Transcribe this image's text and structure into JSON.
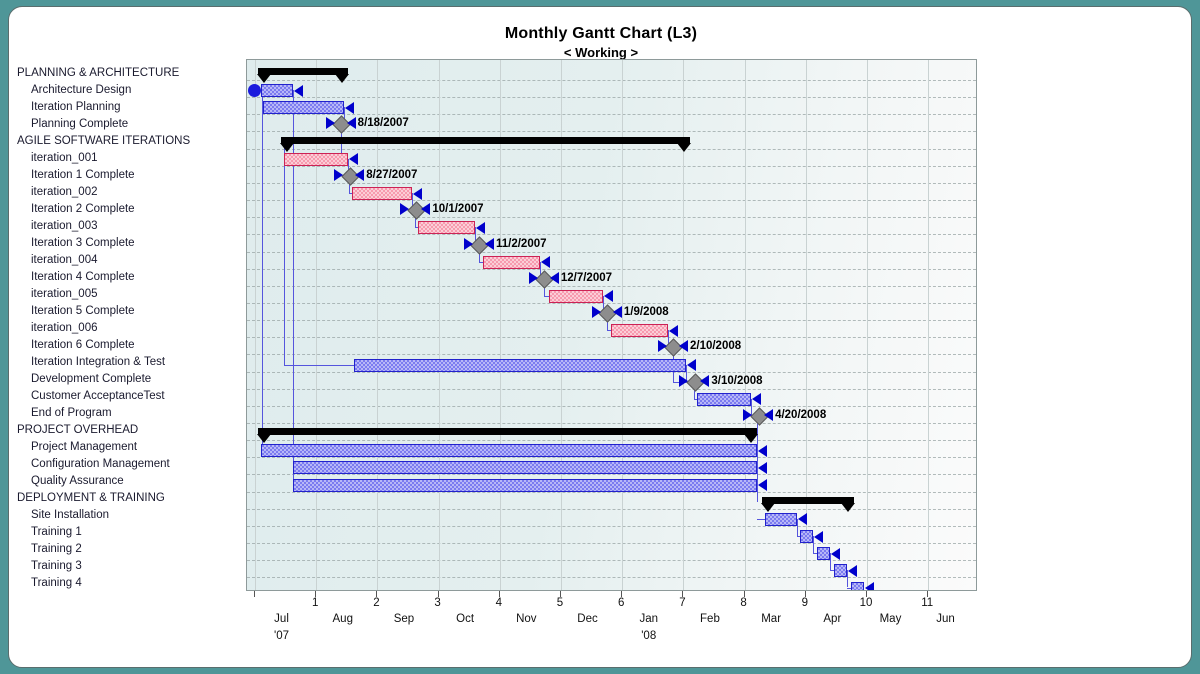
{
  "header": {
    "title": "Monthly Gantt Chart  (L3)",
    "subtitle": "< Working >"
  },
  "tasks": [
    {
      "label": "PLANNING & ARCHITECTURE",
      "type": "group"
    },
    {
      "label": "Architecture Design",
      "type": "task"
    },
    {
      "label": "Iteration Planning",
      "type": "task"
    },
    {
      "label": "Planning Complete",
      "type": "milestone"
    },
    {
      "label": "AGILE SOFTWARE ITERATIONS",
      "type": "group"
    },
    {
      "label": "iteration_001",
      "type": "task"
    },
    {
      "label": "Iteration 1 Complete",
      "type": "milestone"
    },
    {
      "label": "iteration_002",
      "type": "task"
    },
    {
      "label": "Iteration 2 Complete",
      "type": "milestone"
    },
    {
      "label": "iteration_003",
      "type": "task"
    },
    {
      "label": "Iteration 3 Complete",
      "type": "milestone"
    },
    {
      "label": "iteration_004",
      "type": "task"
    },
    {
      "label": "Iteration 4 Complete",
      "type": "milestone"
    },
    {
      "label": "iteration_005",
      "type": "task"
    },
    {
      "label": "Iteration 5 Complete",
      "type": "milestone"
    },
    {
      "label": "iteration_006",
      "type": "task"
    },
    {
      "label": "Iteration 6 Complete",
      "type": "milestone"
    },
    {
      "label": "Iteration Integration & Test",
      "type": "task"
    },
    {
      "label": "Development Complete",
      "type": "milestone"
    },
    {
      "label": "Customer AcceptanceTest",
      "type": "task"
    },
    {
      "label": "End of Program",
      "type": "milestone"
    },
    {
      "label": "PROJECT OVERHEAD",
      "type": "group"
    },
    {
      "label": "Project Management",
      "type": "task"
    },
    {
      "label": "Configuration Management",
      "type": "task"
    },
    {
      "label": "Quality Assurance",
      "type": "task"
    },
    {
      "label": "DEPLOYMENT & TRAINING",
      "type": "group"
    },
    {
      "label": "Site Installation",
      "type": "task"
    },
    {
      "label": "Training 1",
      "type": "task"
    },
    {
      "label": "Training 2",
      "type": "task"
    },
    {
      "label": "Training 3",
      "type": "task"
    },
    {
      "label": "Training 4",
      "type": "task"
    }
  ],
  "chart_data": {
    "type": "bar",
    "subtype": "gantt",
    "title": "Monthly Gantt Chart  (L3)",
    "subtitle": "< Working >",
    "xlabel": "",
    "ylabel": "",
    "xlim": [
      0,
      11.6
    ],
    "axis_unit": "months",
    "grid": true,
    "legend_position": "none",
    "x_ticks": [
      {
        "value": 0,
        "label": "0",
        "shown": false
      },
      {
        "value": 1,
        "label": "1"
      },
      {
        "value": 2,
        "label": "2"
      },
      {
        "value": 3,
        "label": "3"
      },
      {
        "value": 4,
        "label": "4"
      },
      {
        "value": 5,
        "label": "5"
      },
      {
        "value": 6,
        "label": "6"
      },
      {
        "value": 7,
        "label": "7"
      },
      {
        "value": 8,
        "label": "8"
      },
      {
        "value": 9,
        "label": "9"
      },
      {
        "value": 10,
        "label": "10"
      },
      {
        "value": 11,
        "label": "11"
      }
    ],
    "month_labels": [
      {
        "value": 0.45,
        "label": "Jul",
        "year": "'07"
      },
      {
        "value": 1.45,
        "label": "Aug"
      },
      {
        "value": 2.45,
        "label": "Sep"
      },
      {
        "value": 3.45,
        "label": "Oct"
      },
      {
        "value": 4.45,
        "label": "Nov"
      },
      {
        "value": 5.45,
        "label": "Dec"
      },
      {
        "value": 6.45,
        "label": "Jan",
        "year": "'08"
      },
      {
        "value": 7.45,
        "label": "Feb"
      },
      {
        "value": 8.45,
        "label": "Mar"
      },
      {
        "value": 9.45,
        "label": "Apr"
      },
      {
        "value": 10.4,
        "label": "May"
      },
      {
        "value": 11.3,
        "label": "Jun"
      }
    ],
    "bars": [
      {
        "row": 0,
        "name": "PLANNING & ARCHITECTURE",
        "kind": "summary",
        "start": 0.05,
        "end": 1.52
      },
      {
        "row": 1,
        "name": "Architecture Design",
        "kind": "task",
        "color": "blue",
        "start": 0.1,
        "end": 0.62,
        "start_marker": "circle"
      },
      {
        "row": 2,
        "name": "Iteration Planning",
        "kind": "task",
        "color": "blue",
        "start": 0.13,
        "end": 1.45
      },
      {
        "row": 3,
        "name": "Planning Complete",
        "kind": "milestone",
        "at": 1.4,
        "date": "8/18/2007"
      },
      {
        "row": 4,
        "name": "AGILE SOFTWARE ITERATIONS",
        "kind": "summary",
        "start": 0.42,
        "end": 7.1
      },
      {
        "row": 5,
        "name": "iteration_001",
        "kind": "task",
        "color": "pink",
        "start": 0.47,
        "end": 1.52
      },
      {
        "row": 6,
        "name": "Iteration 1 Complete",
        "kind": "milestone",
        "at": 1.54,
        "date": "8/27/2007"
      },
      {
        "row": 7,
        "name": "iteration_002",
        "kind": "task",
        "color": "pink",
        "start": 1.59,
        "end": 2.57
      },
      {
        "row": 8,
        "name": "Iteration 2 Complete",
        "kind": "milestone",
        "at": 2.62,
        "date": "10/1/2007"
      },
      {
        "row": 9,
        "name": "iteration_003",
        "kind": "task",
        "color": "pink",
        "start": 2.66,
        "end": 3.6
      },
      {
        "row": 10,
        "name": "Iteration 3 Complete",
        "kind": "milestone",
        "at": 3.66,
        "date": "11/2/2007"
      },
      {
        "row": 11,
        "name": "iteration_004",
        "kind": "task",
        "color": "pink",
        "start": 3.73,
        "end": 4.66
      },
      {
        "row": 12,
        "name": "Iteration 4 Complete",
        "kind": "milestone",
        "at": 4.72,
        "date": "12/7/2007"
      },
      {
        "row": 13,
        "name": "iteration_005",
        "kind": "task",
        "color": "pink",
        "start": 4.8,
        "end": 5.69
      },
      {
        "row": 14,
        "name": "Iteration 5 Complete",
        "kind": "milestone",
        "at": 5.75,
        "date": "1/9/2008"
      },
      {
        "row": 15,
        "name": "iteration_006",
        "kind": "task",
        "color": "pink",
        "start": 5.82,
        "end": 6.75
      },
      {
        "row": 16,
        "name": "Iteration 6 Complete",
        "kind": "milestone",
        "at": 6.83,
        "date": "2/10/2008"
      },
      {
        "row": 17,
        "name": "Iteration Integration & Test",
        "kind": "task",
        "color": "blue",
        "start": 1.62,
        "end": 7.05
      },
      {
        "row": 18,
        "name": "Development Complete",
        "kind": "milestone",
        "at": 7.18,
        "date": "3/10/2008"
      },
      {
        "row": 19,
        "name": "Customer AcceptanceTest",
        "kind": "task",
        "color": "blue",
        "start": 7.22,
        "end": 8.11
      },
      {
        "row": 20,
        "name": "End of Program",
        "kind": "milestone",
        "at": 8.22,
        "date": "4/20/2008"
      },
      {
        "row": 21,
        "name": "PROJECT OVERHEAD",
        "kind": "summary",
        "start": 0.05,
        "end": 8.2
      },
      {
        "row": 22,
        "name": "Project Management",
        "kind": "task",
        "color": "blue",
        "start": 0.09,
        "end": 8.2
      },
      {
        "row": 23,
        "name": "Configuration Management",
        "kind": "task",
        "color": "blue",
        "start": 0.62,
        "end": 8.2
      },
      {
        "row": 24,
        "name": "Quality Assurance",
        "kind": "task",
        "color": "blue",
        "start": 0.62,
        "end": 8.2
      },
      {
        "row": 25,
        "name": "DEPLOYMENT & TRAINING",
        "kind": "summary",
        "start": 8.28,
        "end": 9.78
      },
      {
        "row": 26,
        "name": "Site Installation",
        "kind": "task",
        "color": "blue",
        "start": 8.34,
        "end": 8.85
      },
      {
        "row": 27,
        "name": "Training 1",
        "kind": "task",
        "color": "blue",
        "start": 8.9,
        "end": 9.12
      },
      {
        "row": 28,
        "name": "Training 2",
        "kind": "task",
        "color": "blue",
        "start": 9.18,
        "end": 9.4
      },
      {
        "row": 29,
        "name": "Training 3",
        "kind": "task",
        "color": "blue",
        "start": 9.46,
        "end": 9.68
      },
      {
        "row": 30,
        "name": "Training 4",
        "kind": "task",
        "color": "blue",
        "start": 9.74,
        "end": 9.95
      }
    ],
    "milestone_dates": [
      "8/18/2007",
      "8/27/2007",
      "10/1/2007",
      "11/2/2007",
      "12/7/2007",
      "1/9/2008",
      "2/10/2008",
      "3/10/2008",
      "4/20/2008"
    ]
  },
  "colors": {
    "page_background": "#4f9698",
    "panel": "#ffffff",
    "plot_background": "#e4efef",
    "bar_blue": "#7b7bf0",
    "bar_blue_border": "#2222cc",
    "bar_pink": "#f79aae",
    "bar_pink_border": "#cc2255",
    "summary_bar": "#000000",
    "milestone": "#8d8d8d",
    "link_line": "#5555dd",
    "grid_line": "#9aa6a6"
  }
}
